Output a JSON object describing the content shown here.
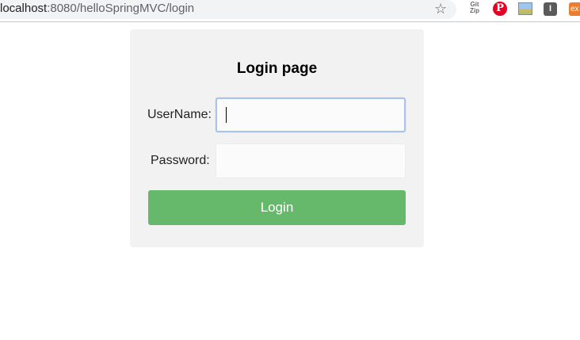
{
  "browser": {
    "url_host": "localhost",
    "url_rest": ":8080/helloSpringMVC/login",
    "extensions": {
      "gitzip_top": "Git",
      "gitzip_bottom": "Zip",
      "pinterest": "P",
      "dark": "I",
      "orange": "ex"
    }
  },
  "login": {
    "title": "Login page",
    "username_label": "UserName:",
    "username_value": "",
    "password_label": "Password:",
    "password_value": "",
    "submit_label": "Login"
  },
  "colors": {
    "card_background": "#f2f2f2",
    "button_green": "#66b96b",
    "focus_border": "#a9c4ea"
  }
}
